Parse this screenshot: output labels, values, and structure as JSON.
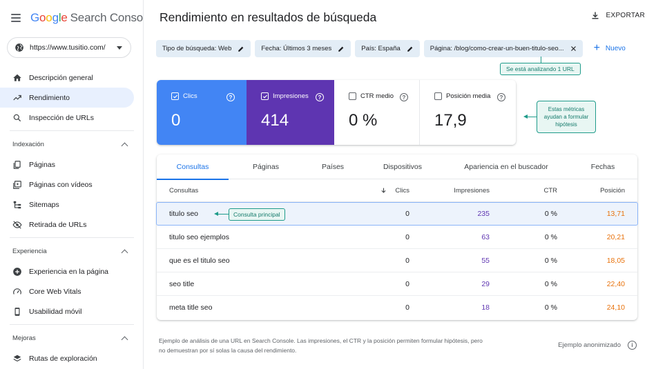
{
  "app": {
    "logo": {
      "g": "G",
      "o1": "o",
      "o2": "o",
      "g2": "g",
      "l": "l",
      "e": "e",
      "product": "Search Console"
    }
  },
  "property": {
    "url": "https://www.tusitio.com/"
  },
  "sidebar": {
    "items_top": [
      {
        "label": "Descripción general",
        "icon": "home-icon"
      },
      {
        "label": "Rendimiento",
        "icon": "trending-up-icon",
        "active": true
      },
      {
        "label": "Inspección de URLs",
        "icon": "search-icon"
      }
    ],
    "sections": [
      {
        "title": "Indexación",
        "items": [
          {
            "label": "Páginas",
            "icon": "pages-icon"
          },
          {
            "label": "Páginas con vídeos",
            "icon": "video-pages-icon"
          },
          {
            "label": "Sitemaps",
            "icon": "sitemap-icon"
          },
          {
            "label": "Retirada de URLs",
            "icon": "eye-off-icon"
          }
        ]
      },
      {
        "title": "Experiencia",
        "items": [
          {
            "label": "Experiencia en la página",
            "icon": "plus-circle-icon"
          },
          {
            "label": "Core Web Vitals",
            "icon": "speedometer-icon"
          },
          {
            "label": "Usabilidad móvil",
            "icon": "smartphone-icon"
          }
        ]
      },
      {
        "title": "Mejoras",
        "items": [
          {
            "label": "Rutas de exploración",
            "icon": "layers-icon"
          }
        ]
      }
    ]
  },
  "header": {
    "title": "Rendimiento en resultados de búsqueda",
    "export_label": "EXPORTAR"
  },
  "filters": {
    "chips": [
      "Tipo de búsqueda: Web",
      "Fecha: Últimos 3 meses",
      "País: España",
      "Página: /blog/como-crear-un-buen-titulo-seo..."
    ],
    "new_label": "Nuevo"
  },
  "callouts": {
    "url": "Se está analizando 1 URL",
    "metrics": "Estas métricas ayudan a formular hipótesis",
    "query": "Consulta principal"
  },
  "metrics": [
    {
      "label": "Clics",
      "value": "0",
      "checked": true
    },
    {
      "label": "Impresiones",
      "value": "414",
      "checked": true
    },
    {
      "label": "CTR medio",
      "value": "0 %",
      "checked": false
    },
    {
      "label": "Posición media",
      "value": "17,9",
      "checked": false
    }
  ],
  "tabs": [
    "Consultas",
    "Páginas",
    "Países",
    "Dispositivos",
    "Apariencia en el buscador",
    "Fechas"
  ],
  "table": {
    "headers": {
      "query": "Consultas",
      "clicks": "Clics",
      "impressions": "Impresiones",
      "ctr": "CTR",
      "position": "Posición"
    },
    "rows": [
      {
        "query": "titulo seo",
        "clicks": "0",
        "impressions": "235",
        "ctr": "0 %",
        "position": "13,71"
      },
      {
        "query": "titulo seo ejemplos",
        "clicks": "0",
        "impressions": "63",
        "ctr": "0 %",
        "position": "20,21"
      },
      {
        "query": "que es el titulo seo",
        "clicks": "0",
        "impressions": "55",
        "ctr": "0 %",
        "position": "18,05"
      },
      {
        "query": "seo title",
        "clicks": "0",
        "impressions": "29",
        "ctr": "0 %",
        "position": "22,40"
      },
      {
        "query": "meta title seo",
        "clicks": "0",
        "impressions": "18",
        "ctr": "0 %",
        "position": "24,10"
      }
    ]
  },
  "footer": {
    "note": "Ejemplo de análisis de una URL en Search Console. Las impresiones, el CTR y la posición permiten formular hipótesis, pero no demuestran por sí solas la causa del rendimiento.",
    "anon": "Ejemplo anonimizado"
  },
  "colors": {
    "clicks": "#4285f4",
    "impressions": "#5e35b1",
    "position": "#e8710a",
    "accent": "#1a73e8",
    "callout": "#1e9b8a"
  }
}
